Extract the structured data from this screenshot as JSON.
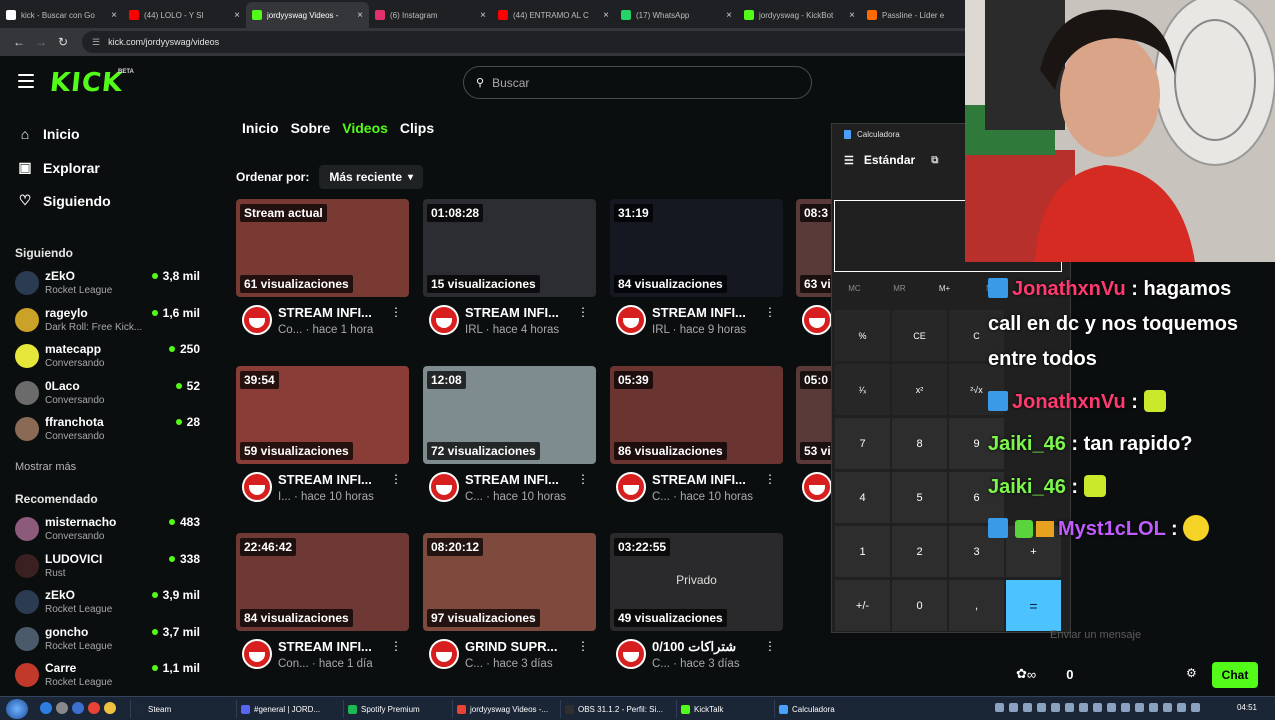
{
  "browser": {
    "tabs": [
      {
        "label": "kick - Buscar con Go",
        "color": "#ffffff",
        "active": false
      },
      {
        "label": "(44) LOLO - Y SI",
        "color": "#ff0000",
        "active": false
      },
      {
        "label": "jordyyswag Videos -",
        "color": "#53fc18",
        "active": true
      },
      {
        "label": "(6) Instagram",
        "color": "#e1306c",
        "active": false
      },
      {
        "label": "(44) ENTRAMO AL C",
        "color": "#ff0000",
        "active": false
      },
      {
        "label": "(17) WhatsApp",
        "color": "#25d366",
        "active": false
      },
      {
        "label": "jordyyswag - KickBot",
        "color": "#53fc18",
        "active": false
      },
      {
        "label": "Passline - Líder e",
        "color": "#ff6a00",
        "active": false
      }
    ],
    "close_glyph": "×",
    "url": "kick.com/jordyyswag/videos"
  },
  "header": {
    "logo": "KICK",
    "beta": "BETA",
    "search_placeholder": "Buscar"
  },
  "sidebar": {
    "nav": [
      {
        "label": "Inicio",
        "icon": "home-icon",
        "glyph": "⌂"
      },
      {
        "label": "Explorar",
        "icon": "compass-icon",
        "glyph": "▣"
      },
      {
        "label": "Siguiendo",
        "icon": "heart-icon",
        "glyph": "♡"
      }
    ],
    "following_title": "Siguiendo",
    "following": [
      {
        "name": "zEkO",
        "game": "Rocket League",
        "viewers": "3,8 mil",
        "avatar": "#2a3b52"
      },
      {
        "name": "rageylo",
        "game": "Dark Roll: Free Kick...",
        "viewers": "1,6 mil",
        "avatar": "#c9a227"
      },
      {
        "name": "matecapp",
        "game": "Conversando",
        "viewers": "250",
        "avatar": "#e5e53a"
      },
      {
        "name": "0Laco",
        "game": "Conversando",
        "viewers": "52",
        "avatar": "#6b6b6b"
      },
      {
        "name": "ffranchota",
        "game": "Conversando",
        "viewers": "28",
        "avatar": "#8a6a55"
      }
    ],
    "show_more": "Mostrar más",
    "recommended_title": "Recomendado",
    "recommended": [
      {
        "name": "misternacho",
        "game": "Conversando",
        "viewers": "483",
        "avatar": "#8c5a7a"
      },
      {
        "name": "LUDOVICI",
        "game": "Rust",
        "viewers": "338",
        "avatar": "#3a2020"
      },
      {
        "name": "zEkO",
        "game": "Rocket League",
        "viewers": "3,9 mil",
        "avatar": "#2a3b52"
      },
      {
        "name": "goncho",
        "game": "Rocket League",
        "viewers": "3,7 mil",
        "avatar": "#4a5a6a"
      },
      {
        "name": "Carre",
        "game": "Rocket League",
        "viewers": "1,1 mil",
        "avatar": "#c0392b"
      }
    ]
  },
  "profile_tabs": [
    {
      "label": "Inicio",
      "active": false
    },
    {
      "label": "Sobre",
      "active": false
    },
    {
      "label": "Videos",
      "active": true
    },
    {
      "label": "Clips",
      "active": false
    }
  ],
  "sort": {
    "label": "Ordenar por:",
    "value": "Más reciente"
  },
  "videos": [
    {
      "badge": "Stream actual",
      "views": "61 visualizaciones",
      "title": "STREAM INFI...",
      "meta": "Co... · hace 1 hora",
      "bg": "#7a3a34"
    },
    {
      "badge": "01:08:28",
      "views": "15 visualizaciones",
      "title": "STREAM INFI...",
      "meta": "IRL · hace 4 horas",
      "bg": "#2c2d33"
    },
    {
      "badge": "31:19",
      "views": "84 visualizaciones",
      "title": "STREAM INFI...",
      "meta": "IRL · hace 9 horas",
      "bg": "#151820"
    },
    {
      "badge": "39:54",
      "views": "59 visualizaciones",
      "title": "STREAM INFI...",
      "meta": "I... · hace 10 horas",
      "bg": "#8a3d36"
    },
    {
      "badge": "12:08",
      "views": "72 visualizaciones",
      "title": "STREAM INFI...",
      "meta": "C... · hace 10 horas",
      "bg": "#7f8c8f"
    },
    {
      "badge": "05:39",
      "views": "86 visualizaciones",
      "title": "STREAM INFI...",
      "meta": "C... · hace 10 horas",
      "bg": "#6a3531"
    },
    {
      "badge": "22:46:42",
      "views": "84 visualizaciones",
      "title": "STREAM INFI...",
      "meta": "Con... · hace 1 día",
      "bg": "#6e3934"
    },
    {
      "badge": "08:20:12",
      "views": "97 visualizaciones",
      "title": "GRIND SUPR...",
      "meta": "C... · hace 3 días",
      "bg": "#7d4a3d"
    },
    {
      "badge": "03:22:55",
      "views": "49 visualizaciones",
      "title": "0/100 شتراكات",
      "meta": "C... · hace 3 días",
      "bg": "#2a2a2c",
      "private": "Privado"
    }
  ],
  "partial_videos": [
    {
      "badge": "08:3",
      "views": "63 vi"
    },
    {
      "badge": "05:0",
      "views": "53 vi"
    }
  ],
  "calculator": {
    "app": "Calculadora",
    "mode": "Estándar",
    "memory": [
      "MC",
      "MR",
      "M+",
      "M"
    ],
    "keys": [
      [
        "%",
        "CE",
        "C"
      ],
      [
        "¹⁄ₓ",
        "x²",
        "²√x"
      ],
      [
        "7",
        "8",
        "9"
      ],
      [
        "4",
        "5",
        "6"
      ],
      [
        "1",
        "2",
        "3"
      ],
      [
        "+/-",
        "0",
        ","
      ]
    ],
    "ops": [
      "+",
      "="
    ]
  },
  "chat": {
    "messages": [
      {
        "user": "JonathxnVu",
        "sep": " : ",
        "text": "hagamos",
        "user_color": "red",
        "icons": [
          "blue"
        ]
      },
      {
        "user": "",
        "sep": "",
        "text": "call en dc y nos toquemos",
        "user_color": "",
        "icons": []
      },
      {
        "user": "",
        "sep": "",
        "text": "entre todos",
        "user_color": "",
        "icons": []
      },
      {
        "user": "JonathxnVu",
        "sep": " : ",
        "text": "",
        "user_color": "red",
        "icons": [
          "blue"
        ],
        "emote": "emote"
      },
      {
        "user": "Jaiki_46",
        "sep": " : ",
        "text": "tan rapido?",
        "user_color": "green",
        "icons": []
      },
      {
        "user": "Jaiki_46",
        "sep": " : ",
        "text": "",
        "user_color": "green",
        "icons": [],
        "emote": "emote"
      },
      {
        "user": "Myst1cLOL",
        "sep": " : ",
        "text": "",
        "user_color": "purple",
        "icons": [
          "blue",
          "green",
          "gold"
        ],
        "emote": "smile"
      }
    ],
    "input_placeholder": "Enviar un mensaje",
    "footer_value": "0",
    "infinity": "∞",
    "send_label": "Chat"
  },
  "taskbar": {
    "items": [
      {
        "label": "Steam",
        "color": "#1b2838"
      },
      {
        "label": "#general | JORD...",
        "color": "#5865f2"
      },
      {
        "label": "Spotify Premium",
        "color": "#1db954"
      },
      {
        "label": "jordyyswag Videos -...",
        "color": "#ea4335"
      },
      {
        "label": "OBS 31.1.2 - Perfil: Si...",
        "color": "#302e31"
      },
      {
        "label": "KickTalk",
        "color": "#53fc18"
      },
      {
        "label": "Calculadora",
        "color": "#4aa0ff"
      }
    ],
    "clock": "04:51"
  }
}
